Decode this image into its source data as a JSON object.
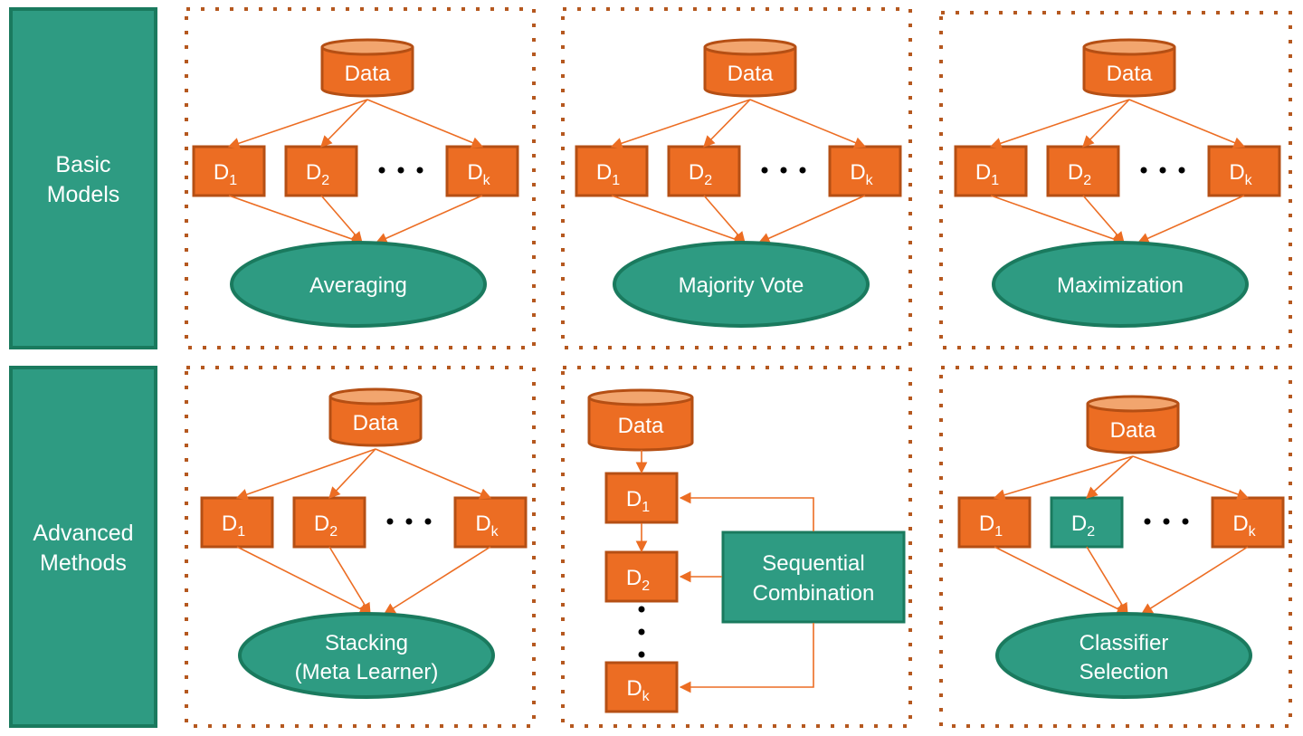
{
  "rows": [
    {
      "label_line1": "Basic",
      "label_line2": "Models"
    },
    {
      "label_line1": "Advanced",
      "label_line2": "Methods"
    }
  ],
  "node_labels": {
    "data": "Data",
    "d_prefix": "D",
    "sub_1": "1",
    "sub_2": "2",
    "sub_k": "k",
    "ellipsis": "• • •"
  },
  "panels": {
    "averaging": {
      "label": "Averaging"
    },
    "majority_vote": {
      "label": "Majority Vote"
    },
    "maximization": {
      "label": "Maximization"
    },
    "stacking": {
      "label_line1": "Stacking",
      "label_line2": "(Meta Learner)"
    },
    "sequential": {
      "label_line1": "Sequential",
      "label_line2": "Combination"
    },
    "classifier_selection": {
      "label_line1": "Classifier",
      "label_line2": "Selection",
      "highlighted_classifier": "D2"
    }
  },
  "colors": {
    "teal": "#2e9b82",
    "teal_border": "#1a7a5e",
    "orange": "#ec6d23",
    "orange_border": "#b54f14",
    "panel_border": "#b5581f"
  }
}
